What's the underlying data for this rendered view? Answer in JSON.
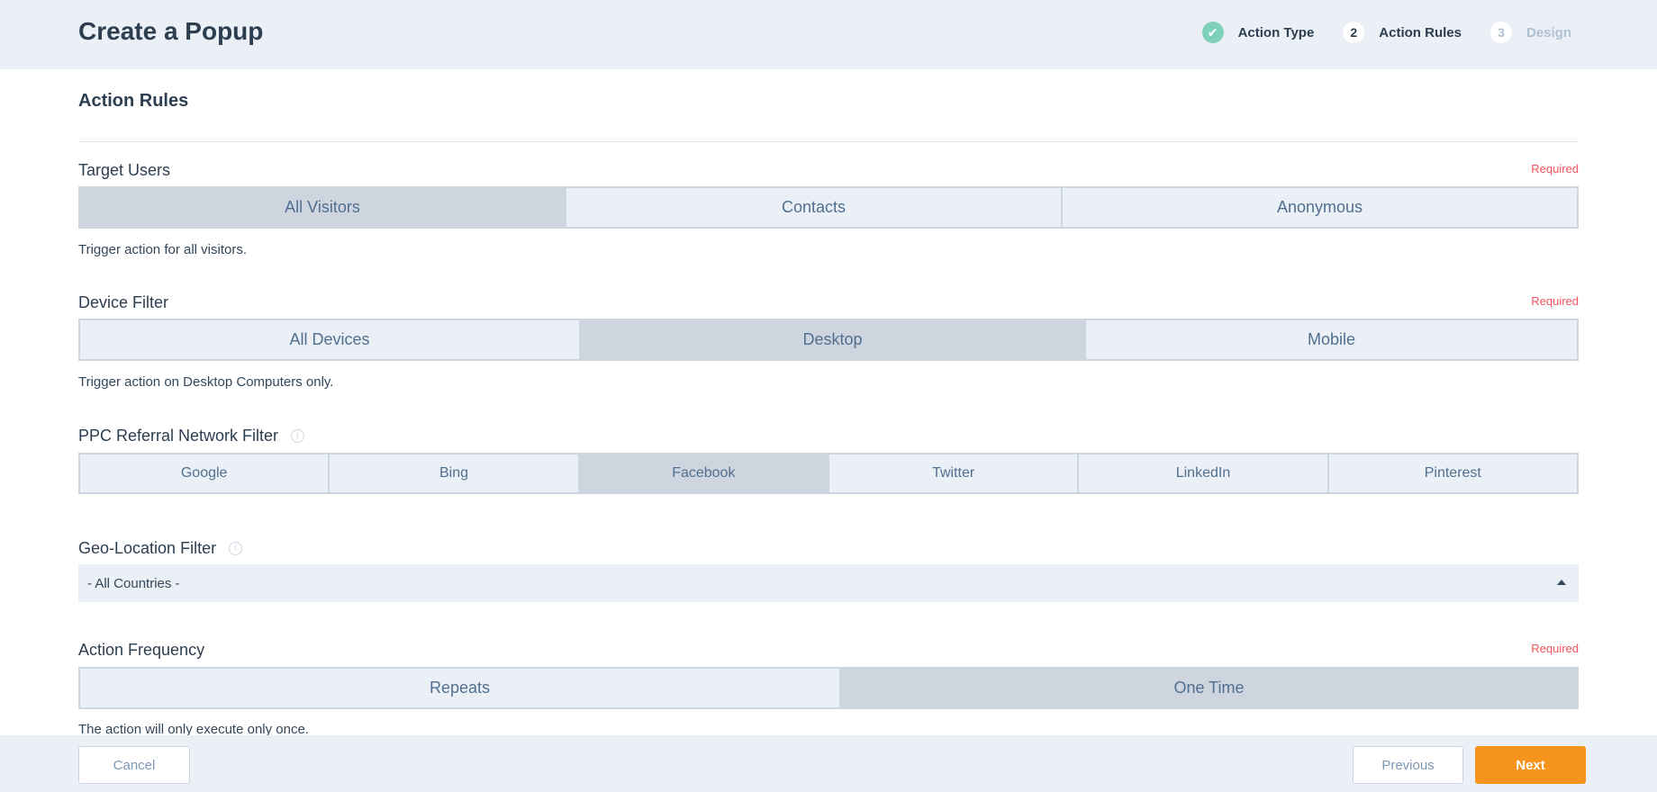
{
  "header": {
    "title": "Create a Popup",
    "steps": [
      {
        "marker": "✔",
        "label": "Action Type",
        "state": "done"
      },
      {
        "marker": "2",
        "label": "Action Rules",
        "state": "active"
      },
      {
        "marker": "3",
        "label": "Design",
        "state": "pending"
      }
    ]
  },
  "section_title": "Action Rules",
  "required_label": "Required",
  "target_users": {
    "label": "Target Users",
    "options": [
      "All Visitors",
      "Contacts",
      "Anonymous"
    ],
    "selected": "All Visitors",
    "help": "Trigger action for all visitors."
  },
  "device_filter": {
    "label": "Device Filter",
    "options": [
      "All Devices",
      "Desktop",
      "Mobile"
    ],
    "selected": "Desktop",
    "help": "Trigger action on Desktop Computers only."
  },
  "ppc_filter": {
    "label": "PPC Referral Network Filter",
    "options": [
      "Google",
      "Bing",
      "Facebook",
      "Twitter",
      "LinkedIn",
      "Pinterest"
    ],
    "selected": "Facebook"
  },
  "geo_filter": {
    "label": "Geo-Location Filter",
    "value": "- All Countries -"
  },
  "action_frequency": {
    "label": "Action Frequency",
    "options": [
      "Repeats",
      "One Time"
    ],
    "selected": "One Time",
    "help": "The action will only execute only once."
  },
  "footer": {
    "cancel": "Cancel",
    "previous": "Previous",
    "next": "Next"
  },
  "colors": {
    "accent": "#f7941d",
    "required": "#f2545b",
    "done": "#7fd1b9"
  }
}
